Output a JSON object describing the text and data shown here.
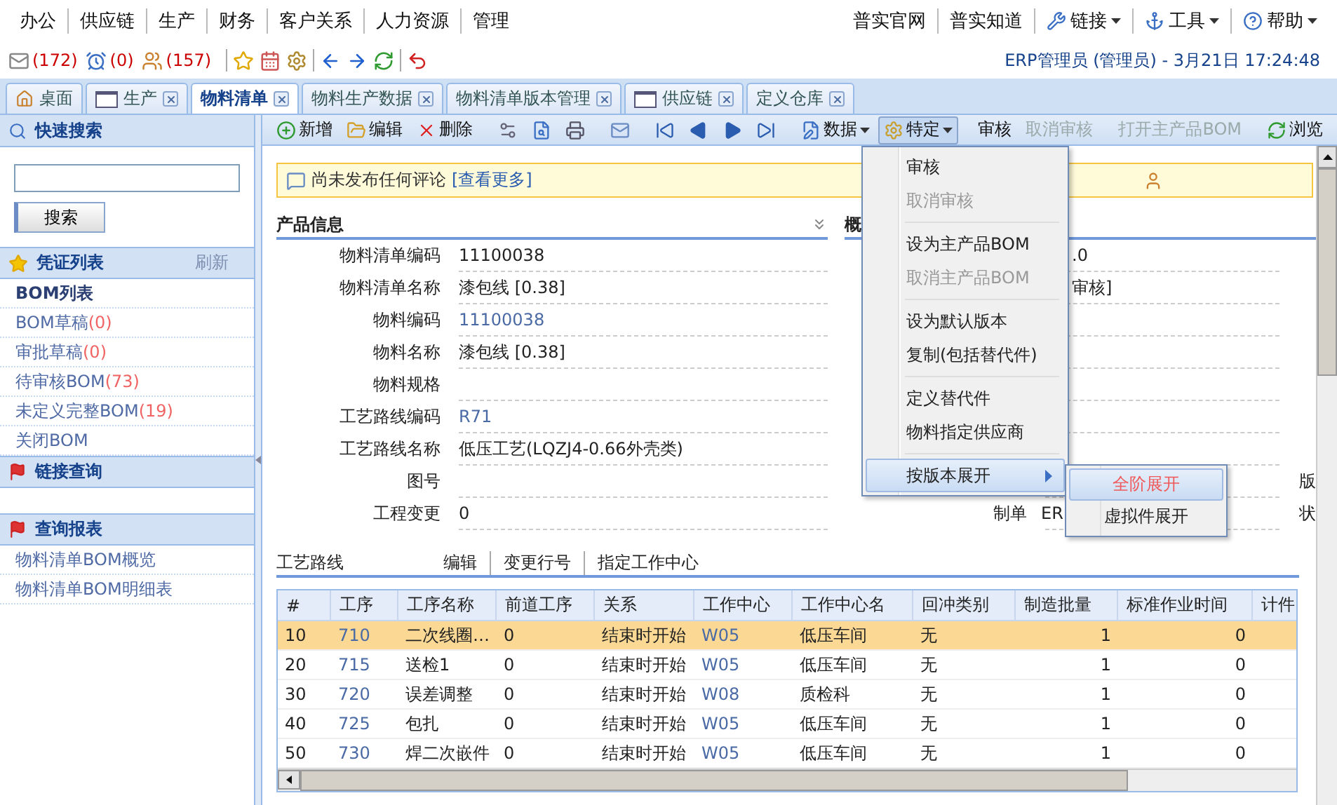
{
  "menu_bar": {
    "left": [
      "办公",
      "供应链",
      "生产",
      "财务",
      "客户关系",
      "人力资源",
      "管理"
    ],
    "right": [
      {
        "label": "普实官网",
        "dropdown": false
      },
      {
        "label": "普实知道",
        "dropdown": false
      },
      {
        "label": "链接",
        "dropdown": true
      },
      {
        "label": "工具",
        "dropdown": true
      },
      {
        "label": "帮助",
        "dropdown": true
      }
    ]
  },
  "counters": [
    "(172)",
    "(0)",
    "(157)"
  ],
  "user_info": "ERP管理员 (管理员) - 3月21日 17:24:48",
  "tabs": [
    {
      "label": "桌面",
      "selected": false,
      "closable": false
    },
    {
      "label": "生产",
      "selected": false,
      "closable": true
    },
    {
      "label": "物料清单",
      "selected": true,
      "closable": true
    },
    {
      "label": "物料生产数据",
      "selected": false,
      "closable": true
    },
    {
      "label": "物料清单版本管理",
      "selected": false,
      "closable": true
    },
    {
      "label": "供应链",
      "selected": false,
      "closable": true
    },
    {
      "label": "定义仓库",
      "selected": false,
      "closable": true
    }
  ],
  "sidebar": {
    "search_title": "快速搜索",
    "search_button": "搜索",
    "sections": [
      {
        "title": "凭证列表",
        "action": "刷新",
        "items": [
          {
            "text": "BOM列表",
            "selected": true
          },
          {
            "text": "BOM草稿",
            "count": "(0)",
            "selected": false
          },
          {
            "text": "审批草稿",
            "count": "(0)",
            "selected": false
          },
          {
            "text": "待审核BOM",
            "count": "(73)",
            "selected": false
          },
          {
            "text": "未定义完整BOM",
            "count": "(19)",
            "selected": false
          },
          {
            "text": "关闭BOM",
            "selected": false
          }
        ]
      },
      {
        "title": "链接查询"
      },
      {
        "title": "查询报表",
        "items": [
          {
            "text": "物料清单BOM概览",
            "selected": false
          },
          {
            "text": "物料清单BOM明细表",
            "selected": false
          }
        ]
      }
    ]
  },
  "toolbar": [
    {
      "kind": "button",
      "label": "新增"
    },
    {
      "kind": "button",
      "label": "编辑"
    },
    {
      "kind": "button",
      "label": "删除"
    },
    {
      "kind": "separator"
    },
    {
      "kind": "icon"
    },
    {
      "kind": "icon"
    },
    {
      "kind": "icon"
    },
    {
      "kind": "separator"
    },
    {
      "kind": "icon"
    },
    {
      "kind": "separator"
    },
    {
      "kind": "icon"
    },
    {
      "kind": "icon"
    },
    {
      "kind": "icon"
    },
    {
      "kind": "icon"
    },
    {
      "kind": "separator"
    },
    {
      "kind": "button",
      "label": "数据",
      "dropdown": true,
      "open": false
    },
    {
      "kind": "button",
      "label": "特定",
      "dropdown": true,
      "open": true
    },
    {
      "kind": "separator"
    },
    {
      "kind": "button",
      "label": "审核",
      "disabled": false
    },
    {
      "kind": "button",
      "label": "取消审核",
      "disabled": true
    },
    {
      "kind": "separator"
    },
    {
      "kind": "button",
      "label": "打开主产品BOM",
      "disabled": true
    },
    {
      "kind": "separator"
    },
    {
      "kind": "button",
      "label": "浏览"
    }
  ],
  "comment": {
    "text": "尚未发布任何评论",
    "link": "[查看更多]"
  },
  "form": {
    "left_title": "产品信息",
    "right_title": "概",
    "rows": [
      {
        "label": "物料清单编码",
        "value": "11100038",
        "link": false,
        "right_value": ".0"
      },
      {
        "label": "物料清单名称",
        "value": "漆包线 [0.38]",
        "link": false,
        "right_value": "审核]"
      },
      {
        "label": "物料编码",
        "value": "11100038",
        "link": true
      },
      {
        "label": "物料名称",
        "value": "漆包线 [0.38]",
        "link": false
      },
      {
        "label": "物料规格"
      },
      {
        "label": "工艺路线编码",
        "value": "R71",
        "link": true
      },
      {
        "label": "工艺路线名称",
        "value": "低压工艺(LQZJ4-0.66外壳类)",
        "link": false
      },
      {
        "label": "图号",
        "side": "版"
      },
      {
        "label": "工程变更",
        "value": "0",
        "link": false,
        "right_label": "制单",
        "right_value": "ER",
        "side": "状"
      }
    ]
  },
  "routing": {
    "title": "工艺路线",
    "actions": [
      "编辑",
      "变更行号",
      "指定工作中心"
    ],
    "columns": [
      {
        "label": "#",
        "link": false
      },
      {
        "label": "工序",
        "link": true
      },
      {
        "label": "工序名称",
        "link": false
      },
      {
        "label": "前道工序",
        "link": false
      },
      {
        "label": "关系",
        "link": false
      },
      {
        "label": "工作中心",
        "link": true
      },
      {
        "label": "工作中心名",
        "link": false
      },
      {
        "label": "回冲类别",
        "link": false
      },
      {
        "label": "制造批量",
        "link": false
      },
      {
        "label": "标准作业时间",
        "link": false
      },
      {
        "label": "计件",
        "link": false
      }
    ],
    "rows": [
      {
        "selected": true,
        "cells": [
          "10",
          "710",
          "二次线圈…",
          "0",
          "结束时开始",
          "W05",
          "低压车间",
          "无",
          "1",
          "0"
        ]
      },
      {
        "selected": false,
        "cells": [
          "20",
          "715",
          "送检1",
          "0",
          "结束时开始",
          "W05",
          "低压车间",
          "无",
          "1",
          "0"
        ]
      },
      {
        "selected": false,
        "cells": [
          "30",
          "720",
          "误差调整",
          "0",
          "结束时开始",
          "W08",
          "质检科",
          "无",
          "1",
          "0"
        ]
      },
      {
        "selected": false,
        "cells": [
          "40",
          "725",
          "包扎",
          "0",
          "结束时开始",
          "W05",
          "低压车间",
          "无",
          "1",
          "0"
        ]
      },
      {
        "selected": false,
        "cells": [
          "50",
          "730",
          "焊二次嵌件",
          "0",
          "结束时开始",
          "W05",
          "低压车间",
          "无",
          "1",
          "0"
        ]
      }
    ]
  },
  "menu": {
    "items": [
      {
        "kind": "item",
        "label": "审核",
        "disabled": false
      },
      {
        "kind": "item",
        "label": "取消审核",
        "disabled": true
      },
      {
        "kind": "separator"
      },
      {
        "kind": "item",
        "label": "设为主产品BOM",
        "disabled": false
      },
      {
        "kind": "item",
        "label": "取消主产品BOM",
        "disabled": true
      },
      {
        "kind": "separator"
      },
      {
        "kind": "item",
        "label": "设为默认版本",
        "disabled": false
      },
      {
        "kind": "item",
        "label": "复制(包括替代件)",
        "disabled": false
      },
      {
        "kind": "separator"
      },
      {
        "kind": "item",
        "label": "定义替代件",
        "disabled": false
      },
      {
        "kind": "item",
        "label": "物料指定供应商",
        "disabled": false
      },
      {
        "kind": "separator"
      },
      {
        "kind": "submenu",
        "label": "按版本展开",
        "selected": true
      }
    ],
    "submenu": [
      {
        "label": "全阶展开",
        "selected": true
      },
      {
        "label": "虚拟件展开",
        "selected": false
      }
    ]
  }
}
